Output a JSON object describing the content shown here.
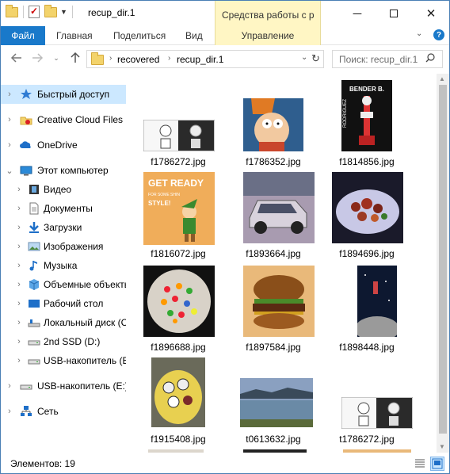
{
  "window": {
    "title": "recup_dir.1",
    "tools_tab": "Средства работы с р",
    "controls": {
      "minimize": "─",
      "close": "✕"
    }
  },
  "ribbon": {
    "file": "Файл",
    "home": "Главная",
    "share": "Поделиться",
    "view": "Вид",
    "manage": "Управление",
    "help": "?"
  },
  "address": {
    "crumbs": [
      "recovered",
      "recup_dir.1"
    ],
    "search_placeholder": "Поиск: recup_dir.1"
  },
  "nav": {
    "quick_access": "Быстрый доступ",
    "creative_cloud": "Creative Cloud Files",
    "onedrive": "OneDrive",
    "this_pc": "Этот компьютер",
    "video": "Видео",
    "documents": "Документы",
    "downloads": "Загрузки",
    "images": "Изображения",
    "music": "Музыка",
    "objects3d": "Объемные объекты",
    "desktop": "Рабочий стол",
    "local_disk": "Локальный диск (C:)",
    "ssd2": "2nd SSD (D:)",
    "usb1": "USB-накопитель (E:)",
    "usb2": "USB-накопитель (E:)",
    "network": "Сеть"
  },
  "files": [
    {
      "name": "f1786272.jpg"
    },
    {
      "name": "f1786352.jpg"
    },
    {
      "name": "f1814856.jpg"
    },
    {
      "name": "f1816072.jpg"
    },
    {
      "name": "f1893664.jpg"
    },
    {
      "name": "f1894696.jpg"
    },
    {
      "name": "f1896688.jpg"
    },
    {
      "name": "f1897584.jpg"
    },
    {
      "name": "f1898448.jpg"
    },
    {
      "name": "f1915408.jpg"
    },
    {
      "name": "t0613632.jpg"
    },
    {
      "name": "t1786272.jpg"
    }
  ],
  "thumb_text": {
    "bender": "BENDER B.",
    "bender_side": "RODRIGUEZ",
    "get_ready": "GET READY",
    "get_ready_sub": "FOR SOME SHIN",
    "get_ready_style": "STYLE!"
  },
  "status": {
    "items": "Элементов: 19"
  },
  "colors": {
    "accent": "#1979ca",
    "tools": "#fff6c4",
    "selected": "#cce8ff"
  }
}
